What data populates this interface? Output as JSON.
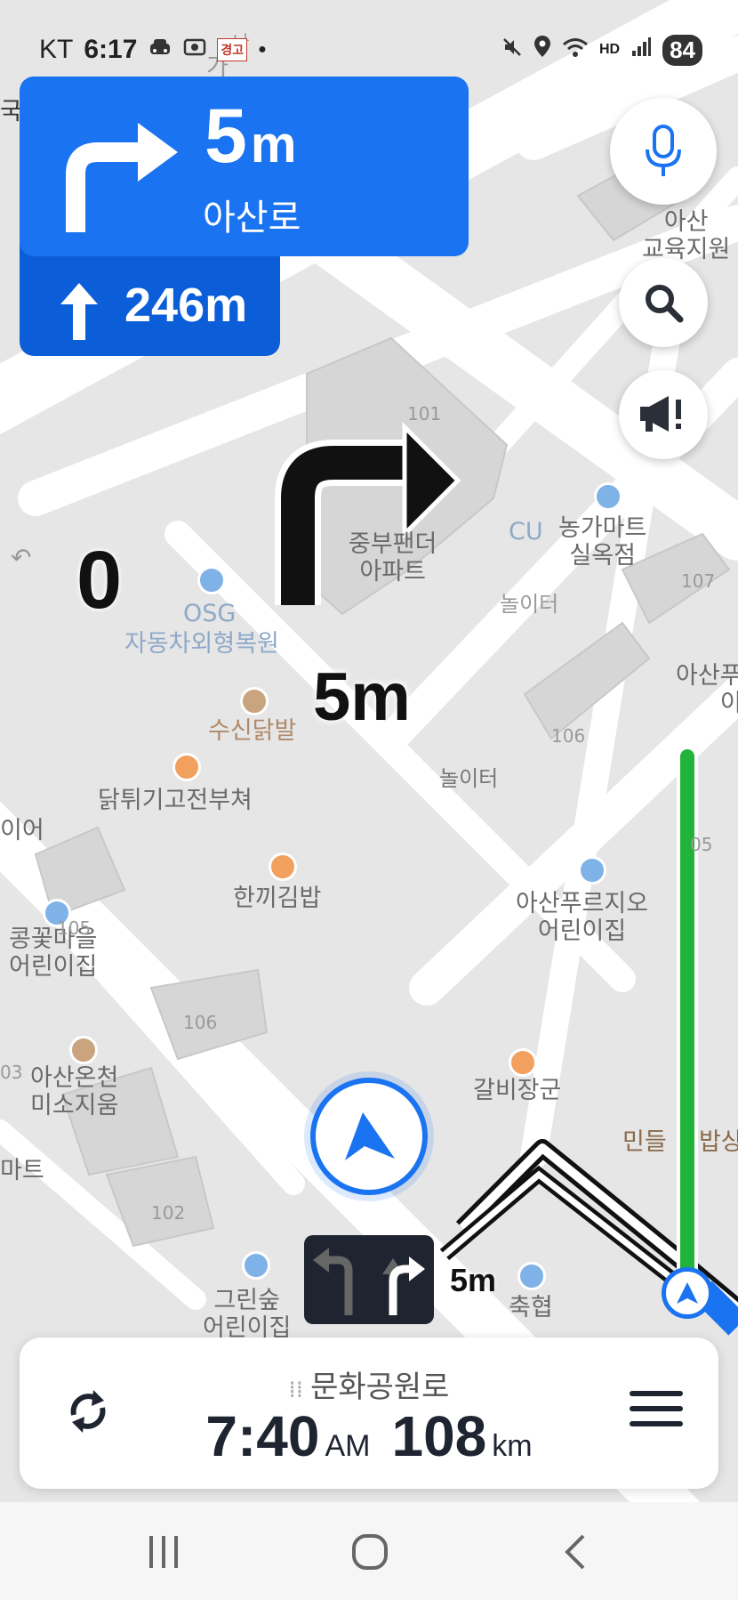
{
  "status_bar": {
    "carrier": "KT",
    "time": "6:17",
    "battery": "84"
  },
  "guidance": {
    "turn_distance": "5",
    "turn_unit": "m",
    "turn_road": "아산로",
    "next_distance": "246m",
    "map_turn_distance": "5m",
    "speed_display": "0",
    "lane_distance": "5m"
  },
  "map_labels": {
    "apartment": "중부팬더\n아파트",
    "nonghyup_mart": "농가마트\n실옥점",
    "osg": "OSG",
    "osg_desc": "자동차외형복원",
    "cu": "CU",
    "playground1": "놀이터",
    "playground2": "놀이터",
    "susin": "수신닭발",
    "dakt": "닭튀기고전부쳐",
    "hankki": "한끼김밥",
    "asan_purgio": "아산푸르지오\n어린이집",
    "kongkkot": "콩꽃마을\n어린이집",
    "asan_oncheon": "아산온천\n미소지움",
    "galbi": "갈비장군",
    "mindeul": "민들",
    "bapsang": "밥상",
    "green": "그린숲\n어린이집",
    "chukhyup": "축협",
    "asan_edu": "아산\n교육지원",
    "asan_right": "아산푸\n이",
    "mart_left": "마트",
    "ieo": "이어",
    "b101": "101",
    "b106a": "106",
    "b106b": "106",
    "b107": "107",
    "b102": "102",
    "b103": "03",
    "b105": "05",
    "b105b": "105",
    "ga": "가",
    "na": "나",
    "guk": "국"
  },
  "bottom_bar": {
    "road_name": "문화공원로",
    "arrival_time": "7:40",
    "arrival_ampm": "AM",
    "remaining_distance": "108",
    "distance_unit": "km"
  },
  "colors": {
    "primary": "#1a73f0",
    "primary_dark": "#0b5ed8",
    "route_green": "#22b33a",
    "dark": "#1e2430"
  },
  "icons": [
    "mic-icon",
    "search-icon",
    "megaphone-icon",
    "reroute-icon",
    "menu-icon",
    "location-arrow-icon",
    "turn-right-icon",
    "straight-icon"
  ]
}
